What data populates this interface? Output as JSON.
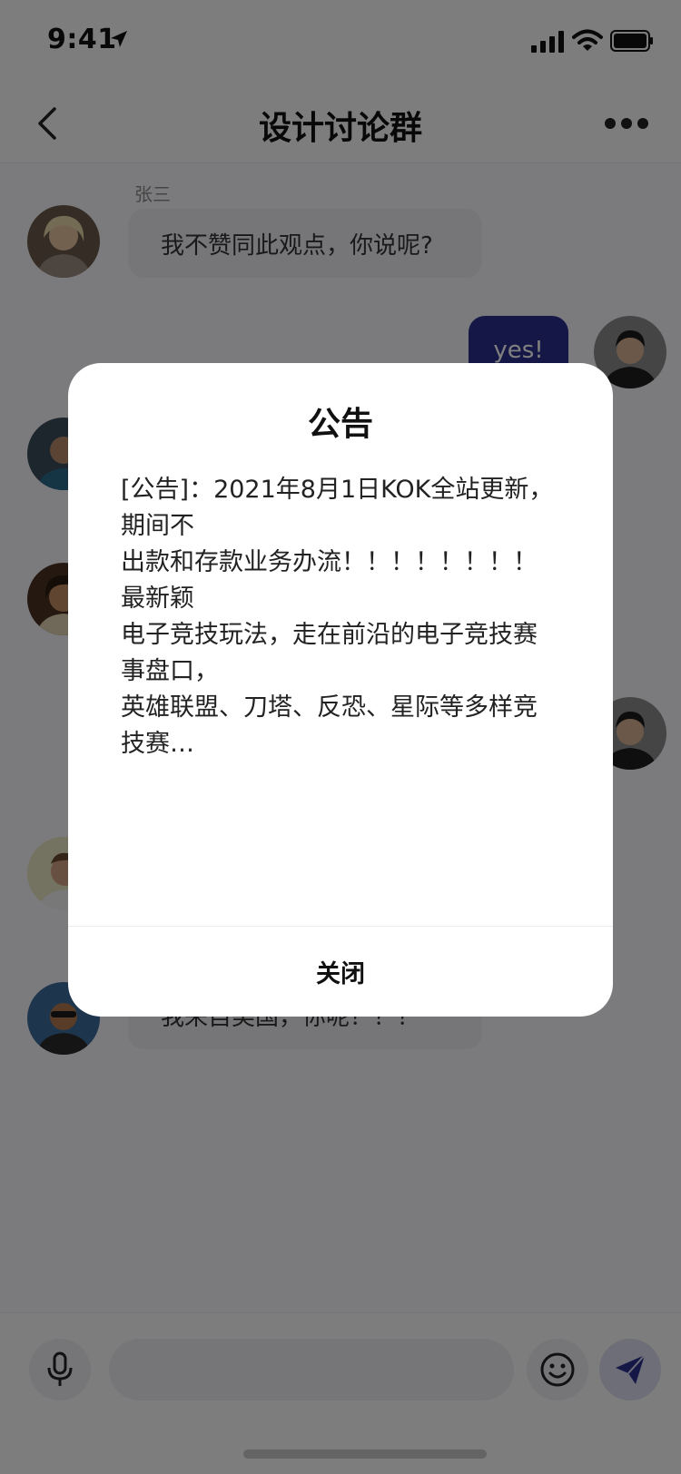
{
  "status_bar": {
    "time": "9:41"
  },
  "nav": {
    "title": "设计讨论群"
  },
  "messages": {
    "m1": {
      "sender": "张三",
      "text": "我不赞同此观点，你说呢?"
    },
    "m2": {
      "text": "yes!"
    },
    "m_last": {
      "text": "我来自美国，你呢？？？"
    }
  },
  "input": {
    "placeholder": ""
  },
  "announcement": {
    "title": "公告",
    "lines": [
      "[公告]：2021年8月1日KOK全站更新，期间不",
      "出款和存款业务办流！！！！！！！！最新颖",
      "电子竞技玩法，走在前沿的电子竞技赛事盘口，",
      "英雄联盟、刀塔、反恐、星际等多样竞技赛…"
    ],
    "close_label": "关闭"
  },
  "colors": {
    "accent": "#2b2f8f",
    "bubble": "#ececf2",
    "overlay": "rgba(0,0,0,0.5)"
  },
  "icons": [
    "location-arrow-icon",
    "signal-icon",
    "wifi-icon",
    "battery-icon",
    "back-icon",
    "more-icon",
    "microphone-icon",
    "emoji-icon",
    "send-icon"
  ]
}
